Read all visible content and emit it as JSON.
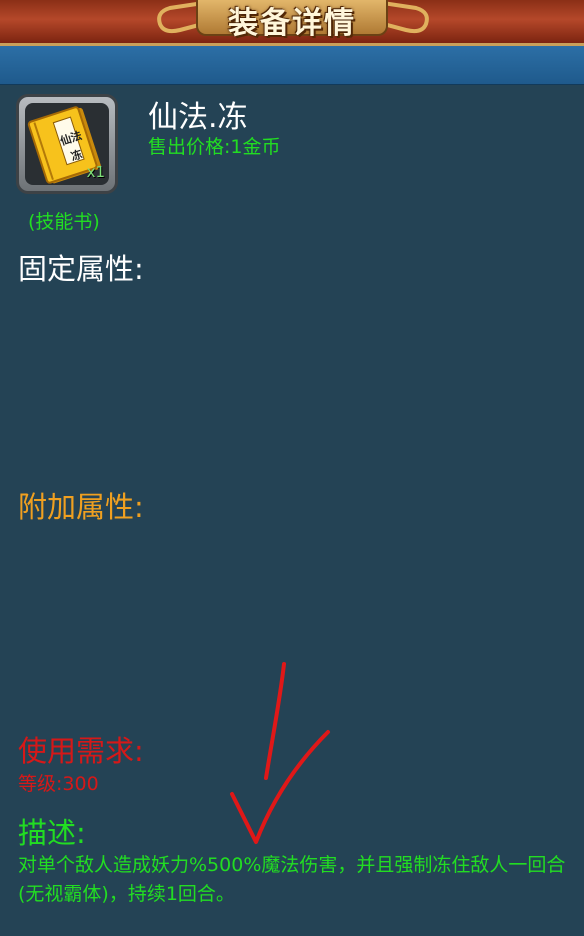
{
  "header": {
    "title": "装备详情"
  },
  "item": {
    "name": "仙法.冻",
    "sell_price": "售出价格:1金币",
    "type": "(技能书)",
    "quantity": "x1",
    "icon": "skill-book-icon",
    "book_label_1": "仙法",
    "book_label_2": "冻"
  },
  "sections": {
    "fixed_attributes": "固定属性:",
    "extra_attributes": "附加属性:",
    "requirements": "使用需求:",
    "requirement_level": "等级:300",
    "description_title": "描述:",
    "description_text": "对单个敌人造成妖力%500%魔法伤害，并且强制冻住敌人一回合(无视霸体)，持续1回合。"
  },
  "colors": {
    "background": "#244355",
    "green": "#22dd22",
    "orange": "#f0a020",
    "red": "#d61818",
    "annotation": "#e01818"
  }
}
